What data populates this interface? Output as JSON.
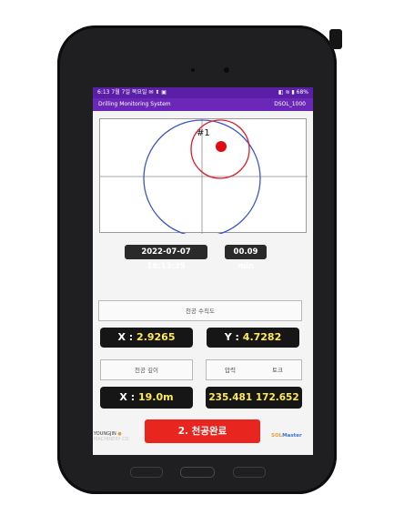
{
  "status_bar": {
    "time_date": "6:13  7월 7일 목요일",
    "status_icons": "✉ ⬆ ▣",
    "battery": "68%",
    "right_icons": "◧ ≋ ▮"
  },
  "app_bar": {
    "title": "Drilling Monitoring System",
    "device_code": "DSOL_1000"
  },
  "plot": {
    "marker_label": "#1",
    "colors": {
      "outer_circle": "#3a56c9",
      "inner_circle": "#d81e2a",
      "dot": "#e10b13",
      "axes": "#888888"
    }
  },
  "info": {
    "timestamp": "2022-07-07 18:13:35",
    "elapsed": "00.09 min"
  },
  "verticality": {
    "label": "천공 수직도",
    "x_prefix": "X :",
    "x_value": "2.9265",
    "y_prefix": "Y :",
    "y_value": "4.7282"
  },
  "depth": {
    "label": "천공 깊이",
    "x_prefix": "X :",
    "x_value": "19.0m"
  },
  "pressure_torque": {
    "pressure_label": "압력",
    "torque_label": "토크",
    "pressure_value": "235.481",
    "torque_value": "172.652"
  },
  "action": {
    "complete_button": "2. 천공완료"
  },
  "footer": {
    "left_brand_line1": "YOUNGJIN",
    "left_brand_line2": "MACHINERY CO.",
    "right_brand_main": "SOL",
    "right_brand_sub": "Master"
  }
}
